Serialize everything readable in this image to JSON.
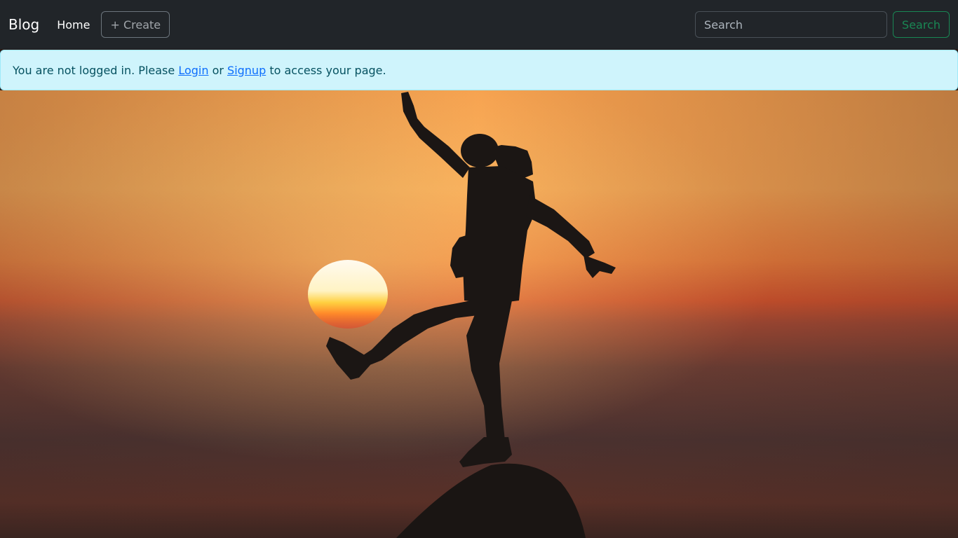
{
  "navbar": {
    "brand": "Blog",
    "home_label": "Home",
    "create_label": "+ Create",
    "search_placeholder": "Search",
    "search_button_label": "Search"
  },
  "alert": {
    "prefix": "You are not logged in. Please ",
    "login_label": "Login",
    "middle": " or ",
    "signup_label": "Signup",
    "suffix": " to access your page."
  },
  "hero": {
    "icon": "sunset-silhouette-image"
  },
  "colors": {
    "navbar_bg": "#212529",
    "alert_bg": "#cff4fc",
    "search_button": "#198754",
    "link": "#0d6efd"
  }
}
